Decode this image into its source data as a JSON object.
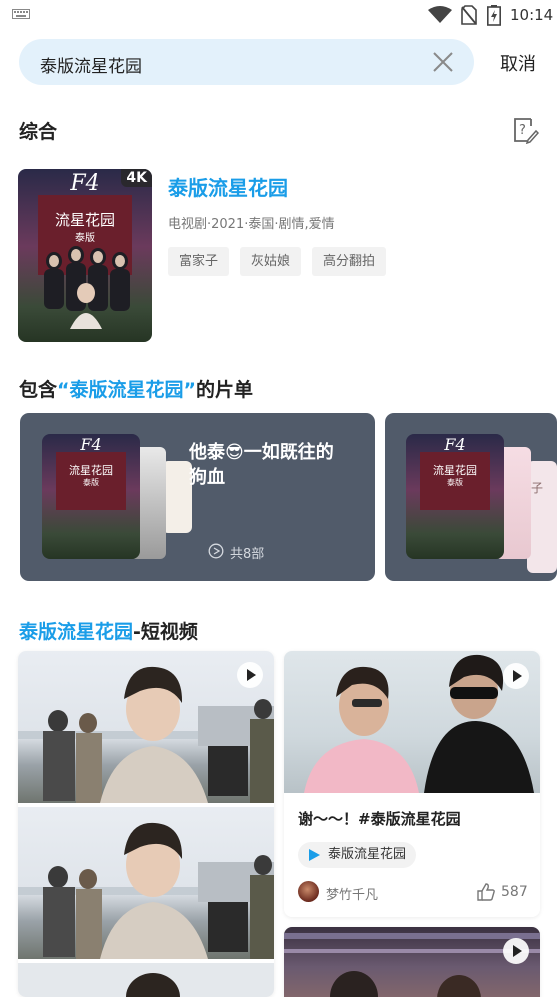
{
  "status_bar": {
    "time": "10:14",
    "icons": [
      "keyboard-icon",
      "wifi-icon",
      "no-sim-icon",
      "battery-charging-icon"
    ]
  },
  "search": {
    "query": "泰版流星花园",
    "cancel_label": "取消"
  },
  "overview": {
    "section_title": "综合",
    "show": {
      "title": "泰版流星花园",
      "meta": "电视剧·2021·泰国·剧情,爱情",
      "badge": "4K",
      "poster_title": "流星花园",
      "poster_subtitle": "泰版",
      "poster_logo": "F4",
      "tags": [
        "富家子",
        "灰姑娘",
        "高分翻拍"
      ]
    }
  },
  "playlists": {
    "title_prefix": "包含",
    "title_highlight": "“泰版流星花园”",
    "title_suffix": "的片单",
    "items": [
      {
        "title": "他泰😎一如既往的狗血",
        "count": "共8部"
      },
      {
        "title": "",
        "count": ""
      }
    ],
    "partial_caption": "子"
  },
  "short_videos": {
    "title_highlight": "泰版流星花园",
    "title_suffix": "-短视频",
    "featured": {
      "title": "谢～～！#泰版流星花园",
      "tag": "泰版流星花园",
      "author": "梦竹千凡",
      "likes": "587"
    }
  },
  "colors": {
    "accent": "#1a9de8",
    "search_bg": "#e3f1fb",
    "playlist_card": "#515b6a"
  }
}
